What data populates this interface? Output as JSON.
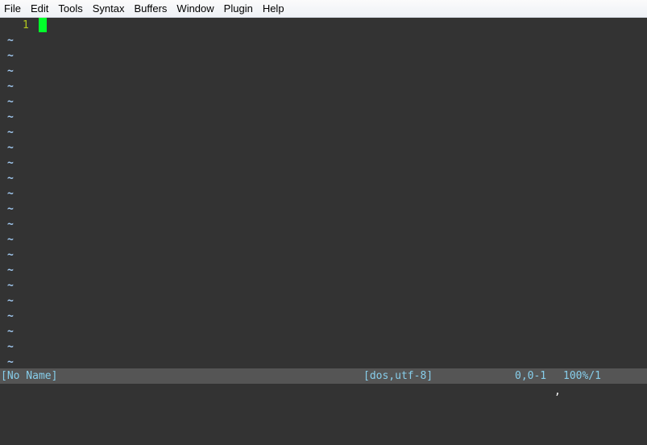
{
  "menubar": {
    "items": [
      "File",
      "Edit",
      "Tools",
      "Syntax",
      "Buffers",
      "Window",
      "Plugin",
      "Help"
    ]
  },
  "editor": {
    "line_number": "1",
    "empty_line_marker": "~",
    "cursor_color": "#00ff2a",
    "background": "#333333"
  },
  "statusline": {
    "filename": "[No Name]",
    "format": "[dos,utf-8]",
    "position": "0,0-1",
    "percent": "100%/1"
  },
  "cmdline": {
    "text": ","
  }
}
